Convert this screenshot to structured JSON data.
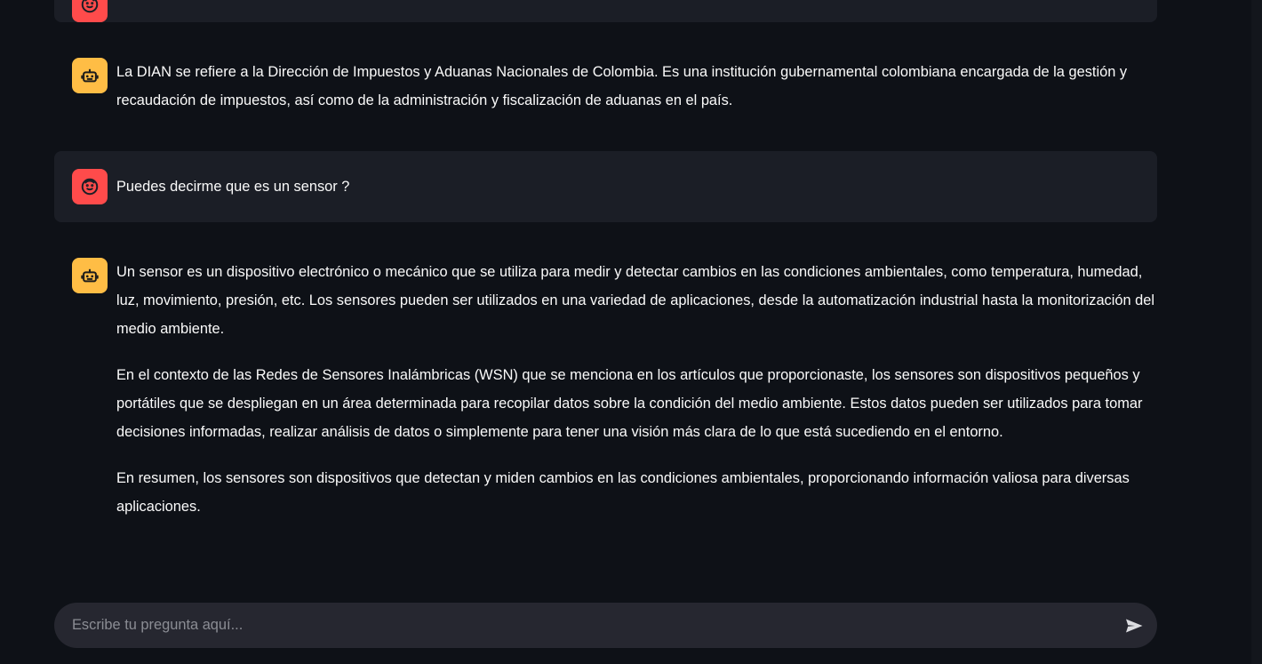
{
  "conversation": {
    "messages": [
      {
        "role": "user",
        "avatar_icon": "user-face-icon",
        "paragraphs": []
      },
      {
        "role": "assistant",
        "avatar_icon": "robot-icon",
        "paragraphs": [
          "La DIAN se refiere a la Dirección de Impuestos y Aduanas Nacionales de Colombia. Es una institución gubernamental colombiana encargada de la gestión y recaudación de impuestos, así como de la administración y fiscalización de aduanas en el país."
        ]
      },
      {
        "role": "user",
        "avatar_icon": "user-face-icon",
        "paragraphs": [
          "Puedes decirme que es un sensor ?"
        ]
      },
      {
        "role": "assistant",
        "avatar_icon": "robot-icon",
        "paragraphs": [
          "Un sensor es un dispositivo electrónico o mecánico que se utiliza para medir y detectar cambios en las condiciones ambientales, como temperatura, humedad, luz, movimiento, presión, etc. Los sensores pueden ser utilizados en una variedad de aplicaciones, desde la automatización industrial hasta la monitorización del medio ambiente.",
          "En el contexto de las Redes de Sensores Inalámbricas (WSN) que se menciona en los artículos que proporcionaste, los sensores son dispositivos pequeños y portátiles que se despliegan en un área determinada para recopilar datos sobre la condición del medio ambiente. Estos datos pueden ser utilizados para tomar decisiones informadas, realizar análisis de datos o simplemente para tener una visión más clara de lo que está sucediendo en el entorno.",
          "En resumen, los sensores son dispositivos que detectan y miden cambios en las condiciones ambientales, proporcionando información valiosa para diversas aplicaciones."
        ]
      }
    ]
  },
  "chat_input": {
    "placeholder": "Escribe tu pregunta aquí...",
    "value": "",
    "send_icon": "send-icon"
  },
  "colors": {
    "background": "#0e1117",
    "user_message_bg": "#1b1e26",
    "user_avatar": "#ff4b4b",
    "bot_avatar": "#ffbd45",
    "input_bg": "#262730",
    "text": "#fafafa"
  }
}
